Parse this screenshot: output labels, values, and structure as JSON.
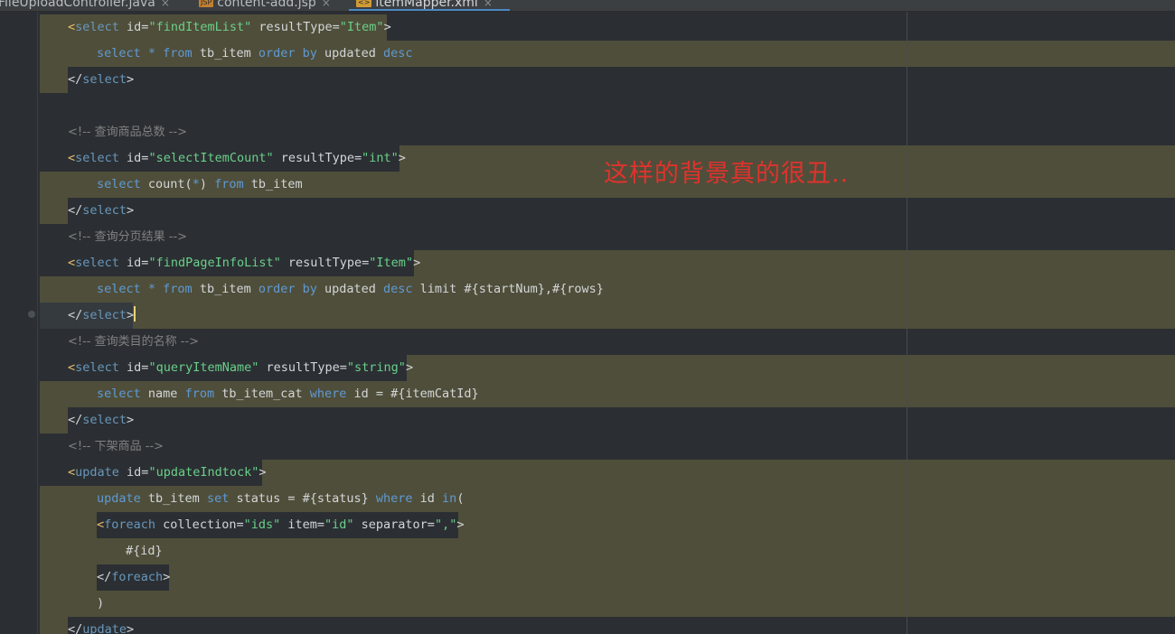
{
  "tabs": [
    {
      "name": "FileUploadController.java",
      "close": "×"
    },
    {
      "badge": "JSP",
      "name": "content-add.jsp",
      "close": "×"
    },
    {
      "badge": "<>",
      "name": "itemMapper.xml",
      "close": "×",
      "active": true
    }
  ],
  "annotation": "这样的背景真的很丑..",
  "lines": {
    "l1": {
      "lt": "<",
      "tag": "select",
      "a1": " id=",
      "v1": "\"findItemList\"",
      "a2": " resultType=",
      "v2": "\"Item\"",
      "gt": ">"
    },
    "l2": {
      "kw1": "select",
      "star": " * ",
      "kw2": "from",
      "t1": " tb_item ",
      "kw3": "order by",
      "t2": " updated ",
      "kw4": "desc"
    },
    "l3": {
      "open": "</",
      "tag": "select",
      "gt": ">"
    },
    "l4": {
      "cmt": "<!-- 查询商品总数 -->"
    },
    "l5": {
      "lt": "<",
      "tag": "select",
      "a1": " id=",
      "v1": "\"selectItemCount\"",
      "a2": " resultType=",
      "v2": "\"int\"",
      "gt": ">"
    },
    "l6": {
      "kw1": "select",
      "t1": " count(",
      "star": "*",
      "t2": ") ",
      "kw2": "from",
      "t3": " tb_item"
    },
    "l7": {
      "open": "</",
      "tag": "select",
      "gt": ">"
    },
    "l8": {
      "cmt": "<!-- 查询分页结果 -->"
    },
    "l9": {
      "lt": "<",
      "tag": "select",
      "a1": " id=",
      "v1": "\"findPageInfoList\"",
      "a2": " resultType=",
      "v2": "\"Item\"",
      "gt": ">"
    },
    "l10": {
      "kw1": "select",
      "star": " * ",
      "kw2": "from",
      "t1": " tb_item ",
      "kw3": "order by",
      "t2": " updated ",
      "kw4": "desc",
      "t3": " limit #{startNum},#{rows}"
    },
    "l11": {
      "open": "</",
      "tag": "select",
      "gt": ">"
    },
    "l12": {
      "cmt": "<!-- 查询类目的名称 -->"
    },
    "l13": {
      "lt": "<",
      "tag": "select",
      "a1": " id=",
      "v1": "\"queryItemName\"",
      "a2": " resultType=",
      "v2": "\"string\"",
      "gt": ">"
    },
    "l14": {
      "kw1": "select",
      "t1": " name ",
      "kw2": "from",
      "t2": " tb_item_cat ",
      "kw3": "where",
      "t3": " id = #{itemCatId}"
    },
    "l15": {
      "open": "</",
      "tag": "select",
      "gt": ">"
    },
    "l16": {
      "cmt": "<!-- 下架商品 -->"
    },
    "l17": {
      "lt": "<",
      "tag": "update",
      "a1": " id=",
      "v1": "\"updateIndtock\"",
      "gt": ">"
    },
    "l18": {
      "kw1": "update",
      "t1": " tb_item ",
      "kw2": "set",
      "t2": " status = #{status} ",
      "kw3": "where",
      "t3": " id ",
      "kw4": "in",
      "t4": "("
    },
    "l19": {
      "lt": "<",
      "tag": "foreach",
      "a1": " collection=",
      "v1": "\"ids\"",
      "a2": " item=",
      "v2": "\"id\"",
      "a3": " separator=",
      "v3": "\",\"",
      "gt": ">"
    },
    "l20": {
      "t1": "#{id}"
    },
    "l21": {
      "open": "</",
      "tag": "foreach",
      "gt": ">"
    },
    "l22": {
      "t1": ")"
    },
    "l23": {
      "open": "</",
      "tag": "update",
      "gt": ">"
    }
  },
  "colors": {
    "background": "#2b2f33",
    "highlight": "#4f4e3a",
    "keyword": "#5e9ad4",
    "string": "#6ad08a",
    "comment": "#808080",
    "annotation": "#e0322d"
  }
}
